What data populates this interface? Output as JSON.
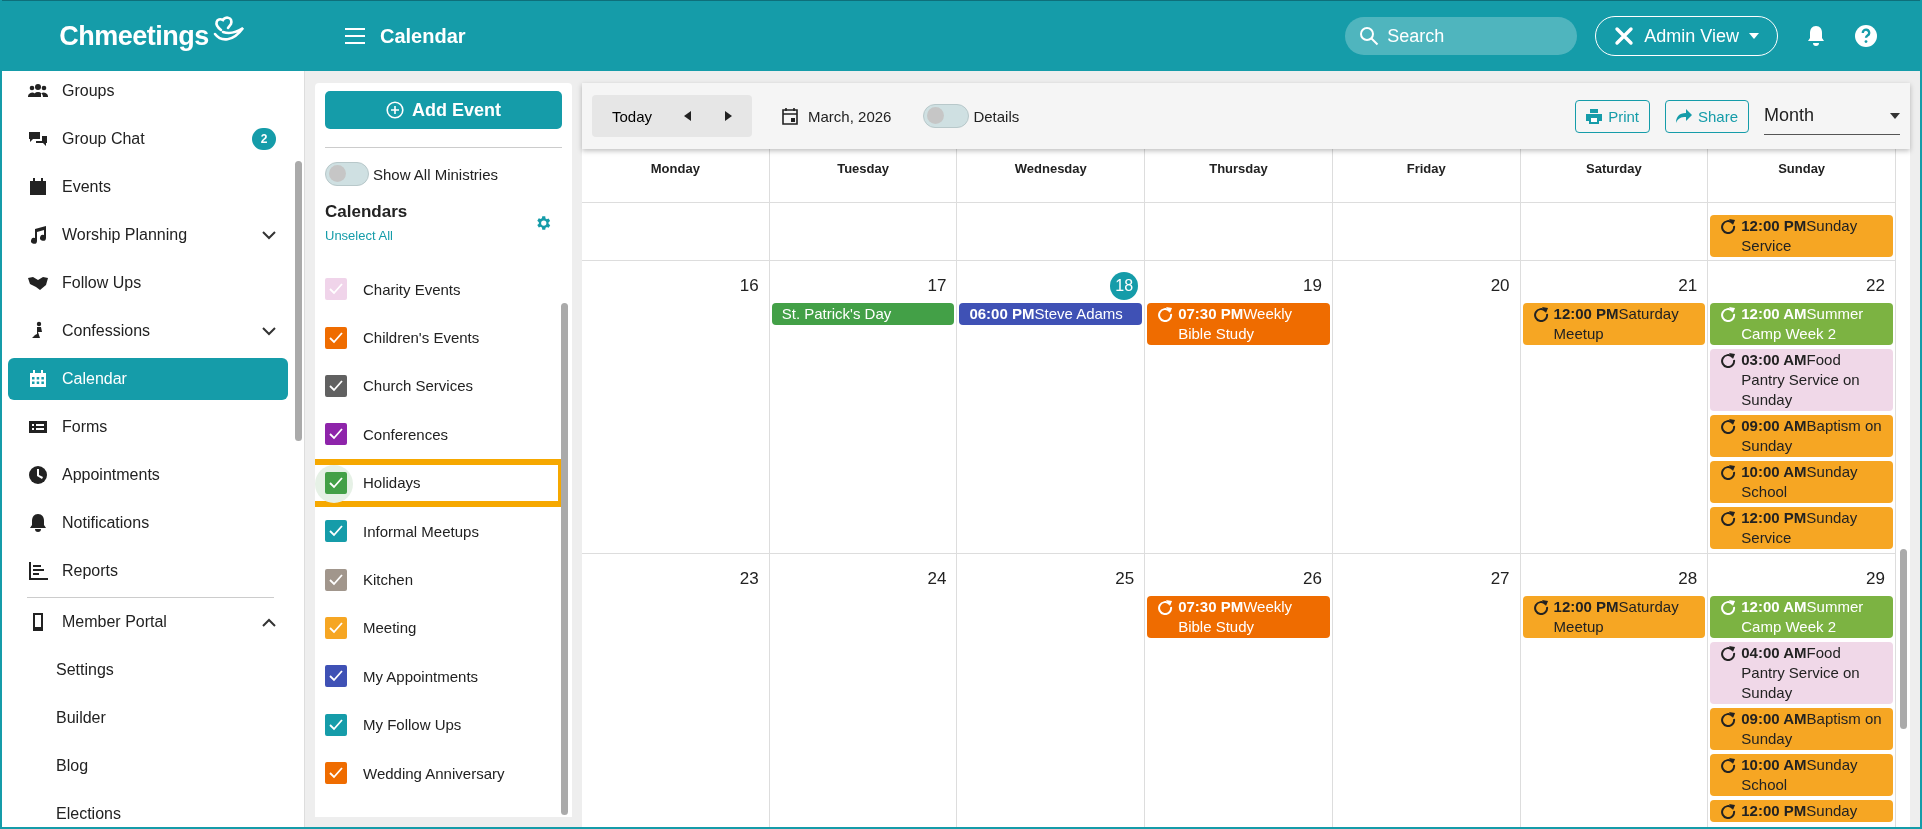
{
  "header": {
    "brand": "Chmeetings",
    "page_title": "Calendar",
    "search": {
      "placeholder": "Search"
    },
    "view_button": "Admin View"
  },
  "sidebar": {
    "items": [
      {
        "label": "Groups",
        "kind": "link",
        "selected": false
      },
      {
        "label": "Group Chat",
        "kind": "link",
        "selected": false,
        "badge": "2"
      },
      {
        "label": "Events",
        "kind": "link",
        "selected": false
      },
      {
        "label": "Worship Planning",
        "kind": "group",
        "selected": false,
        "expanded": false
      },
      {
        "label": "Follow Ups",
        "kind": "link",
        "selected": false
      },
      {
        "label": "Confessions",
        "kind": "group",
        "selected": false,
        "expanded": false
      },
      {
        "label": "Calendar",
        "kind": "link",
        "selected": true
      },
      {
        "label": "Forms",
        "kind": "link",
        "selected": false
      },
      {
        "label": "Appointments",
        "kind": "link",
        "selected": false
      },
      {
        "label": "Notifications",
        "kind": "link",
        "selected": false
      },
      {
        "label": "Reports",
        "kind": "link",
        "selected": false
      },
      {
        "label": "Member Portal",
        "kind": "section",
        "selected": false,
        "expanded": true,
        "children": [
          {
            "label": "Settings",
            "selected": false
          },
          {
            "label": "Builder",
            "selected": false
          },
          {
            "label": "Blog",
            "selected": false
          },
          {
            "label": "Elections",
            "selected": false
          }
        ]
      }
    ]
  },
  "calendars_panel": {
    "add_button": "Add Event",
    "show_all": {
      "label": "Show All Ministries",
      "on": false
    },
    "heading": "Calendars",
    "unselect_link": "Unselect All",
    "items": [
      {
        "label": "Charity Events",
        "color": "#f0d4ea",
        "checked": true,
        "highlighted": false
      },
      {
        "label": "Children's Events",
        "color": "#ef6c00",
        "checked": true,
        "highlighted": false
      },
      {
        "label": "Church Services",
        "color": "#616161",
        "checked": true,
        "highlighted": false
      },
      {
        "label": "Conferences",
        "color": "#8e24aa",
        "checked": true,
        "highlighted": false
      },
      {
        "label": "Holidays",
        "color": "#43a047",
        "checked": true,
        "highlighted": true
      },
      {
        "label": "Informal Meetups",
        "color": "#159ca9",
        "checked": true,
        "highlighted": false
      },
      {
        "label": "Kitchen",
        "color": "#a1968c",
        "checked": true,
        "highlighted": false
      },
      {
        "label": "Meeting",
        "color": "#f6a623",
        "checked": true,
        "highlighted": false
      },
      {
        "label": "My Appointments",
        "color": "#3f51b5",
        "checked": true,
        "highlighted": false
      },
      {
        "label": "My Follow Ups",
        "color": "#159ca9",
        "checked": true,
        "highlighted": false
      },
      {
        "label": "Wedding Anniversary",
        "color": "#ef6c00",
        "checked": true,
        "highlighted": false
      }
    ]
  },
  "toolbar": {
    "today_button": "Today",
    "month_label": "March, 2026",
    "details": {
      "label": "Details",
      "on": false
    },
    "print_button": "Print",
    "share_button": "Share",
    "view_select": "Month"
  },
  "calendar": {
    "weekdays": [
      "Monday",
      "Tuesday",
      "Wednesday",
      "Thursday",
      "Friday",
      "Saturday",
      "Sunday"
    ],
    "weeks": [
      {
        "days": [
          {
            "kind": "undated"
          },
          {
            "kind": "undated"
          },
          {
            "kind": "undated"
          },
          {
            "kind": "undated"
          },
          {
            "kind": "undated"
          },
          {
            "kind": "undated"
          },
          {
            "kind": "undated",
            "events": [
              {
                "time": "12:00 PM",
                "title": "Sunday Service",
                "color": "#f6a623",
                "light_text": false,
                "recurring": true
              }
            ]
          }
        ]
      },
      {
        "days": [
          {
            "date": "16",
            "today": false
          },
          {
            "date": "17",
            "today": false,
            "events": [
              {
                "title": "St. Patrick's Day",
                "color": "#43a047",
                "light_text": true,
                "recurring": false
              }
            ]
          },
          {
            "date": "18",
            "today": true,
            "events": [
              {
                "time": "06:00 PM",
                "title": "Steve Adams",
                "color": "#3f51b5",
                "light_text": true,
                "recurring": false
              }
            ]
          },
          {
            "date": "19",
            "today": false,
            "events": [
              {
                "time": "07:30 PM",
                "title": "Weekly Bible Study",
                "color": "#ef6c00",
                "light_text": true,
                "recurring": true
              }
            ]
          },
          {
            "date": "20",
            "today": false
          },
          {
            "date": "21",
            "today": false,
            "events": [
              {
                "time": "12:00 PM",
                "title": "Saturday Meetup",
                "color": "#f6a623",
                "light_text": false,
                "recurring": true
              }
            ]
          },
          {
            "date": "22",
            "today": false,
            "events": [
              {
                "time": "12:00 AM",
                "title": "Summer Camp Week 2",
                "color": "#7cb342",
                "light_text": true,
                "recurring": true
              },
              {
                "time": "03:00 AM",
                "title": "Food Pantry Service on Sunday",
                "color": "#f0d8e8",
                "light_text": false,
                "recurring": true
              },
              {
                "time": "09:00 AM",
                "title": "Baptism on Sunday",
                "color": "#f6a623",
                "light_text": false,
                "recurring": true
              },
              {
                "time": "10:00 AM",
                "title": "Sunday School",
                "color": "#f6a623",
                "light_text": false,
                "recurring": true
              },
              {
                "time": "12:00 PM",
                "title": "Sunday Service",
                "color": "#f6a623",
                "light_text": false,
                "recurring": true
              }
            ]
          }
        ]
      },
      {
        "days": [
          {
            "date": "23",
            "today": false
          },
          {
            "date": "24",
            "today": false
          },
          {
            "date": "25",
            "today": false
          },
          {
            "date": "26",
            "today": false,
            "events": [
              {
                "time": "07:30 PM",
                "title": "Weekly Bible Study",
                "color": "#ef6c00",
                "light_text": true,
                "recurring": true
              }
            ]
          },
          {
            "date": "27",
            "today": false
          },
          {
            "date": "28",
            "today": false,
            "events": [
              {
                "time": "12:00 PM",
                "title": "Saturday Meetup",
                "color": "#f6a623",
                "light_text": false,
                "recurring": true
              }
            ]
          },
          {
            "date": "29",
            "today": false,
            "events": [
              {
                "time": "12:00 AM",
                "title": "Summer Camp Week 2",
                "color": "#7cb342",
                "light_text": true,
                "recurring": true
              },
              {
                "time": "04:00 AM",
                "title": "Food Pantry Service on Sunday",
                "color": "#f0d8e8",
                "light_text": false,
                "recurring": true
              },
              {
                "time": "09:00 AM",
                "title": "Baptism on Sunday",
                "color": "#f6a623",
                "light_text": false,
                "recurring": true
              },
              {
                "time": "10:00 AM",
                "title": "Sunday School",
                "color": "#f6a623",
                "light_text": false,
                "recurring": true
              },
              {
                "time": "12:00 PM",
                "title": "Sunday",
                "color": "#f6a623",
                "light_text": false,
                "recurring": true
              }
            ]
          }
        ]
      }
    ]
  }
}
